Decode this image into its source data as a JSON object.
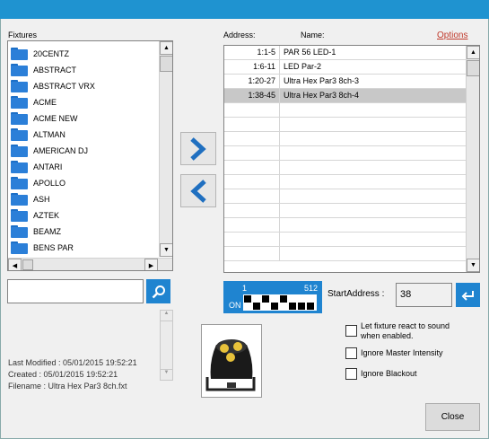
{
  "titlebar": {
    "title": ""
  },
  "fixtures": {
    "label": "Fixtures",
    "items": [
      "20CENTZ",
      "ABSTRACT",
      "ABSTRACT VRX",
      "ACME",
      "ACME NEW",
      "ALTMAN",
      "AMERICAN DJ",
      "ANTARI",
      "APOLLO",
      "ASH",
      "AZTEK",
      "BEAMZ",
      "BENS PAR"
    ]
  },
  "grid": {
    "address_header": "Address:",
    "name_header": "Name:",
    "rows": [
      {
        "address": "1:1-5",
        "name": "PAR 56 LED-1"
      },
      {
        "address": "1:6-11",
        "name": "LED Par-2"
      },
      {
        "address": "1:20-27",
        "name": "Ultra Hex Par3  8ch-3"
      },
      {
        "address": "1:38-45",
        "name": "Ultra Hex Par3  8ch-4"
      }
    ],
    "selected_row": 3
  },
  "options_label": "Options",
  "search": {
    "placeholder": "",
    "value": ""
  },
  "dip": {
    "start": "1",
    "end": "512",
    "on_label": "ON"
  },
  "start_address": {
    "label": "StartAddress :",
    "value": "38"
  },
  "file_info": {
    "last_modified": "Last Modified : 05/01/2015 19:52:21",
    "created": "Created : 05/01/2015 19:52:21",
    "filename": "Filename : Ultra Hex Par3  8ch.fxt"
  },
  "checkboxes": {
    "react_sound": "Let fixture react to sound when enabled.",
    "ignore_master": "Ignore Master Intensity",
    "ignore_blackout": "Ignore Blackout"
  },
  "close_label": "Close",
  "colors": {
    "accent": "#1f84d0",
    "titlebar": "#1f93d0",
    "link": "#c0392b"
  },
  "icons": {
    "folder": "folder-icon",
    "search": "search-icon",
    "enter": "enter-icon",
    "add": "chevron-right-icon",
    "remove": "chevron-left-icon"
  }
}
